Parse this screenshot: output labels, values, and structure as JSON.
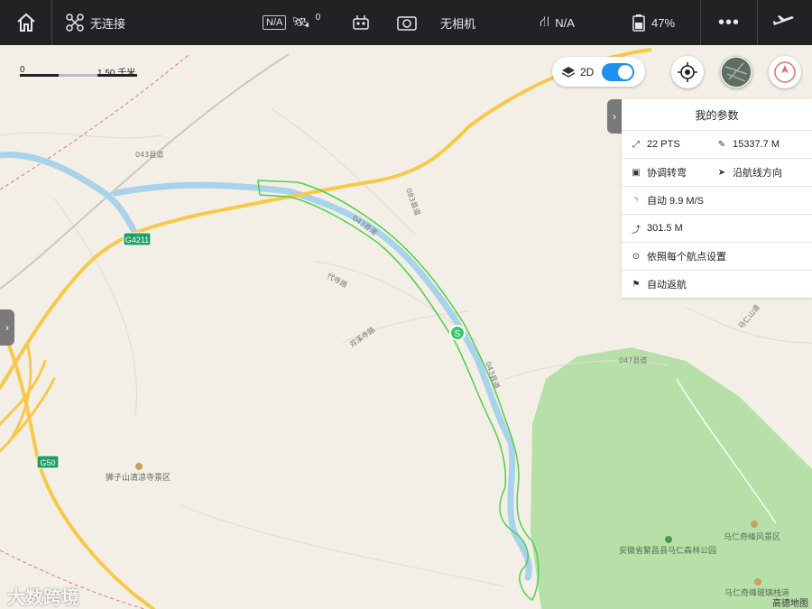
{
  "topbar": {
    "aircraft_status": "无连接",
    "gps_na": "N/A",
    "satellite_count": "0",
    "camera_status": "无相机",
    "flight_mode_value": "N/A",
    "battery_percent": "47%",
    "more_label": "•••"
  },
  "map": {
    "scale_zero": "0",
    "scale_distance": "1.50 千米",
    "view_mode": "2D",
    "view_3d_enabled": true,
    "road_labels": [
      "043县道",
      "043县道",
      "043县道",
      "083县道",
      "代寺路",
      "双溪寺路",
      "047县道",
      "马仁山道"
    ],
    "highway_badges": [
      "G4211",
      "G50"
    ],
    "poi_labels": [
      "狮子山清凉寺景区",
      "马仁奇峰风景区",
      "安徽省繁昌县马仁森林公园",
      "马仁奇峰玻璃栈道"
    ],
    "waypoint_start_label": "S",
    "attribution": "高德地图",
    "watermark": "大数跨境",
    "colors": {
      "flight_path": "#4fd14a",
      "river": "#a9d3ea",
      "road_major": "#f7c94b",
      "forest": "#b7e0a8",
      "start_marker": "#3ec56b"
    }
  },
  "panel": {
    "title": "我的参数",
    "points": "22 PTS",
    "distance": "15337.7 M",
    "turn_mode": "协调转弯",
    "heading_mode": "沿航线方向",
    "speed": "自动  9.9 M/S",
    "altitude": "301.5 M",
    "gimbal_mode": "依照每个航点设置",
    "finish_action": "自动返航"
  }
}
